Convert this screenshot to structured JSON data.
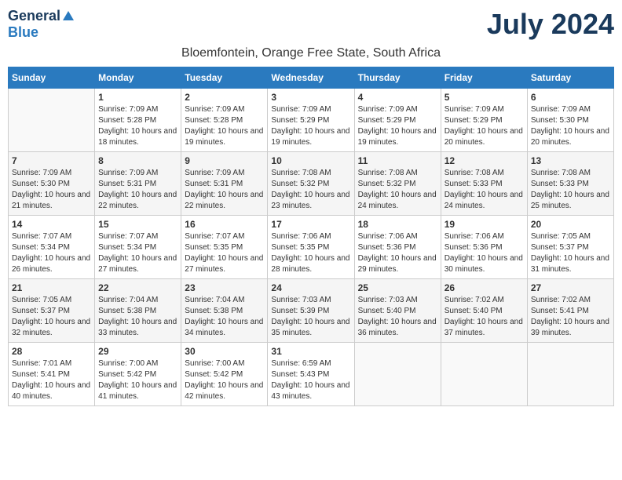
{
  "header": {
    "logo_line1": "General",
    "logo_line2": "Blue",
    "month_title": "July 2024",
    "location": "Bloemfontein, Orange Free State, South Africa"
  },
  "calendar": {
    "weekdays": [
      "Sunday",
      "Monday",
      "Tuesday",
      "Wednesday",
      "Thursday",
      "Friday",
      "Saturday"
    ],
    "weeks": [
      [
        {
          "day": "",
          "sunrise": "",
          "sunset": "",
          "daylight": ""
        },
        {
          "day": "1",
          "sunrise": "Sunrise: 7:09 AM",
          "sunset": "Sunset: 5:28 PM",
          "daylight": "Daylight: 10 hours and 18 minutes."
        },
        {
          "day": "2",
          "sunrise": "Sunrise: 7:09 AM",
          "sunset": "Sunset: 5:28 PM",
          "daylight": "Daylight: 10 hours and 19 minutes."
        },
        {
          "day": "3",
          "sunrise": "Sunrise: 7:09 AM",
          "sunset": "Sunset: 5:29 PM",
          "daylight": "Daylight: 10 hours and 19 minutes."
        },
        {
          "day": "4",
          "sunrise": "Sunrise: 7:09 AM",
          "sunset": "Sunset: 5:29 PM",
          "daylight": "Daylight: 10 hours and 19 minutes."
        },
        {
          "day": "5",
          "sunrise": "Sunrise: 7:09 AM",
          "sunset": "Sunset: 5:29 PM",
          "daylight": "Daylight: 10 hours and 20 minutes."
        },
        {
          "day": "6",
          "sunrise": "Sunrise: 7:09 AM",
          "sunset": "Sunset: 5:30 PM",
          "daylight": "Daylight: 10 hours and 20 minutes."
        }
      ],
      [
        {
          "day": "7",
          "sunrise": "Sunrise: 7:09 AM",
          "sunset": "Sunset: 5:30 PM",
          "daylight": "Daylight: 10 hours and 21 minutes."
        },
        {
          "day": "8",
          "sunrise": "Sunrise: 7:09 AM",
          "sunset": "Sunset: 5:31 PM",
          "daylight": "Daylight: 10 hours and 22 minutes."
        },
        {
          "day": "9",
          "sunrise": "Sunrise: 7:09 AM",
          "sunset": "Sunset: 5:31 PM",
          "daylight": "Daylight: 10 hours and 22 minutes."
        },
        {
          "day": "10",
          "sunrise": "Sunrise: 7:08 AM",
          "sunset": "Sunset: 5:32 PM",
          "daylight": "Daylight: 10 hours and 23 minutes."
        },
        {
          "day": "11",
          "sunrise": "Sunrise: 7:08 AM",
          "sunset": "Sunset: 5:32 PM",
          "daylight": "Daylight: 10 hours and 24 minutes."
        },
        {
          "day": "12",
          "sunrise": "Sunrise: 7:08 AM",
          "sunset": "Sunset: 5:33 PM",
          "daylight": "Daylight: 10 hours and 24 minutes."
        },
        {
          "day": "13",
          "sunrise": "Sunrise: 7:08 AM",
          "sunset": "Sunset: 5:33 PM",
          "daylight": "Daylight: 10 hours and 25 minutes."
        }
      ],
      [
        {
          "day": "14",
          "sunrise": "Sunrise: 7:07 AM",
          "sunset": "Sunset: 5:34 PM",
          "daylight": "Daylight: 10 hours and 26 minutes."
        },
        {
          "day": "15",
          "sunrise": "Sunrise: 7:07 AM",
          "sunset": "Sunset: 5:34 PM",
          "daylight": "Daylight: 10 hours and 27 minutes."
        },
        {
          "day": "16",
          "sunrise": "Sunrise: 7:07 AM",
          "sunset": "Sunset: 5:35 PM",
          "daylight": "Daylight: 10 hours and 27 minutes."
        },
        {
          "day": "17",
          "sunrise": "Sunrise: 7:06 AM",
          "sunset": "Sunset: 5:35 PM",
          "daylight": "Daylight: 10 hours and 28 minutes."
        },
        {
          "day": "18",
          "sunrise": "Sunrise: 7:06 AM",
          "sunset": "Sunset: 5:36 PM",
          "daylight": "Daylight: 10 hours and 29 minutes."
        },
        {
          "day": "19",
          "sunrise": "Sunrise: 7:06 AM",
          "sunset": "Sunset: 5:36 PM",
          "daylight": "Daylight: 10 hours and 30 minutes."
        },
        {
          "day": "20",
          "sunrise": "Sunrise: 7:05 AM",
          "sunset": "Sunset: 5:37 PM",
          "daylight": "Daylight: 10 hours and 31 minutes."
        }
      ],
      [
        {
          "day": "21",
          "sunrise": "Sunrise: 7:05 AM",
          "sunset": "Sunset: 5:37 PM",
          "daylight": "Daylight: 10 hours and 32 minutes."
        },
        {
          "day": "22",
          "sunrise": "Sunrise: 7:04 AM",
          "sunset": "Sunset: 5:38 PM",
          "daylight": "Daylight: 10 hours and 33 minutes."
        },
        {
          "day": "23",
          "sunrise": "Sunrise: 7:04 AM",
          "sunset": "Sunset: 5:38 PM",
          "daylight": "Daylight: 10 hours and 34 minutes."
        },
        {
          "day": "24",
          "sunrise": "Sunrise: 7:03 AM",
          "sunset": "Sunset: 5:39 PM",
          "daylight": "Daylight: 10 hours and 35 minutes."
        },
        {
          "day": "25",
          "sunrise": "Sunrise: 7:03 AM",
          "sunset": "Sunset: 5:40 PM",
          "daylight": "Daylight: 10 hours and 36 minutes."
        },
        {
          "day": "26",
          "sunrise": "Sunrise: 7:02 AM",
          "sunset": "Sunset: 5:40 PM",
          "daylight": "Daylight: 10 hours and 37 minutes."
        },
        {
          "day": "27",
          "sunrise": "Sunrise: 7:02 AM",
          "sunset": "Sunset: 5:41 PM",
          "daylight": "Daylight: 10 hours and 39 minutes."
        }
      ],
      [
        {
          "day": "28",
          "sunrise": "Sunrise: 7:01 AM",
          "sunset": "Sunset: 5:41 PM",
          "daylight": "Daylight: 10 hours and 40 minutes."
        },
        {
          "day": "29",
          "sunrise": "Sunrise: 7:00 AM",
          "sunset": "Sunset: 5:42 PM",
          "daylight": "Daylight: 10 hours and 41 minutes."
        },
        {
          "day": "30",
          "sunrise": "Sunrise: 7:00 AM",
          "sunset": "Sunset: 5:42 PM",
          "daylight": "Daylight: 10 hours and 42 minutes."
        },
        {
          "day": "31",
          "sunrise": "Sunrise: 6:59 AM",
          "sunset": "Sunset: 5:43 PM",
          "daylight": "Daylight: 10 hours and 43 minutes."
        },
        {
          "day": "",
          "sunrise": "",
          "sunset": "",
          "daylight": ""
        },
        {
          "day": "",
          "sunrise": "",
          "sunset": "",
          "daylight": ""
        },
        {
          "day": "",
          "sunrise": "",
          "sunset": "",
          "daylight": ""
        }
      ]
    ]
  }
}
